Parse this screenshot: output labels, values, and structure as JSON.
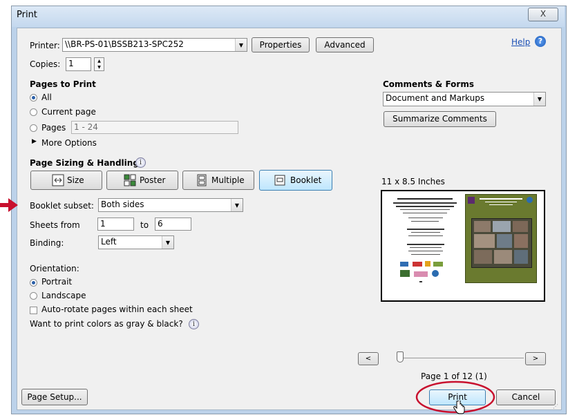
{
  "window": {
    "title": "Print",
    "close_label": "X"
  },
  "printer": {
    "label": "Printer:",
    "value": "\\\\BR-PS-01\\BSSB213-SPC252",
    "properties_label": "Properties",
    "advanced_label": "Advanced"
  },
  "help": {
    "label": "Help",
    "icon_glyph": "?"
  },
  "copies": {
    "label": "Copies:",
    "value": "1"
  },
  "pages_to_print": {
    "heading": "Pages to Print",
    "all_label": "All",
    "current_label": "Current page",
    "pages_label": "Pages",
    "pages_value": "1 - 24",
    "more_options_label": "More Options",
    "selected": "All"
  },
  "comments_forms": {
    "heading": "Comments & Forms",
    "value": "Document and Markups",
    "summarize_label": "Summarize Comments"
  },
  "page_sizing": {
    "heading": "Page Sizing & Handling",
    "info_glyph": "i",
    "tabs": [
      {
        "label": "Size",
        "icon": "size-icon"
      },
      {
        "label": "Poster",
        "icon": "poster-icon"
      },
      {
        "label": "Multiple",
        "icon": "multiple-icon"
      },
      {
        "label": "Booklet",
        "icon": "booklet-icon"
      }
    ],
    "active_tab": "Booklet"
  },
  "booklet": {
    "subset_label": "Booklet subset:",
    "subset_value": "Both sides",
    "sheets_label": "Sheets from",
    "sheets_from": "1",
    "sheets_to_label": "to",
    "sheets_to": "6",
    "binding_label": "Binding:",
    "binding_value": "Left"
  },
  "orientation": {
    "label": "Orientation:",
    "portrait_label": "Portrait",
    "landscape_label": "Landscape",
    "selected": "Portrait",
    "autorotate_label": "Auto-rotate pages within each sheet",
    "gray_label": "Want to print colors as gray & black?"
  },
  "preview": {
    "paper_size": "11 x 8.5 Inches",
    "prev_label": "<",
    "next_label": ">",
    "page_indicator": "Page 1 of 12 (1)",
    "slider_fraction": 0
  },
  "footer": {
    "page_setup_label": "Page Setup...",
    "print_label": "Print",
    "cancel_label": "Cancel"
  },
  "colors": {
    "accent_blue": "#2a5fa8",
    "annotation_red": "#c8102e",
    "preview_green": "#6a7a2f"
  }
}
